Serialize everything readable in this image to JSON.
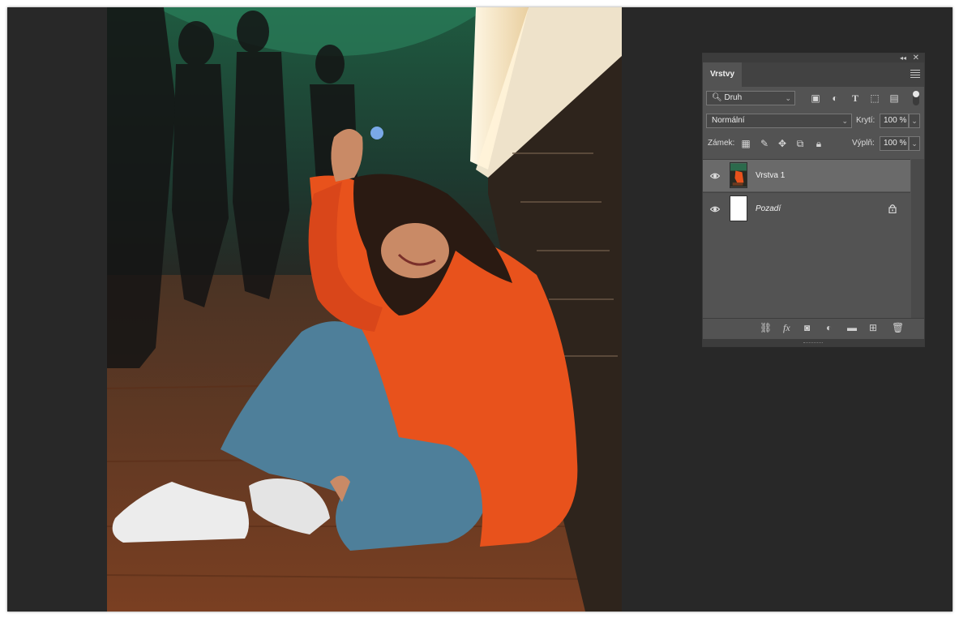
{
  "panel": {
    "title": "Vrstvy",
    "filter": {
      "kind_label": "Druh"
    },
    "blend_mode": "Normální",
    "opacity": {
      "label": "Krytí:",
      "value": "100 %"
    },
    "lock": {
      "label": "Zámek:"
    },
    "fill": {
      "label": "Výplň:",
      "value": "100 %"
    },
    "layers": [
      {
        "name": "Vrstva 1",
        "visible": true,
        "selected": true,
        "locked": false
      },
      {
        "name": "Pozadí",
        "visible": true,
        "selected": false,
        "locked": true
      }
    ]
  },
  "icons": {
    "collapse": "double-chevron-left-icon",
    "close": "close-icon",
    "panel_menu": "hamburger-menu-icon",
    "filter_search": "search-icon",
    "filter_pixel": "image-filter-icon",
    "filter_adjustment": "adjustment-filter-icon",
    "filter_type": "type-filter-icon",
    "filter_shape": "shape-filter-icon",
    "filter_smart": "smart-object-filter-icon",
    "lock_transparent": "lock-transparent-pixels-icon",
    "lock_image": "lock-image-pixels-icon",
    "lock_position": "lock-position-icon",
    "lock_artboard": "lock-artboard-icon",
    "lock_all": "lock-all-icon",
    "visibility": "eye-icon",
    "link": "link-layers-icon",
    "fx": "layer-style-icon",
    "mask": "add-mask-icon",
    "adjustment": "new-adjustment-layer-icon",
    "group": "new-group-folder-icon",
    "new_layer": "new-layer-icon",
    "delete": "trash-icon"
  },
  "colors": {
    "workspace": "#282828",
    "panel": "#535353",
    "selected_layer": "#6a6a6a",
    "jacket": "#e8521c"
  }
}
